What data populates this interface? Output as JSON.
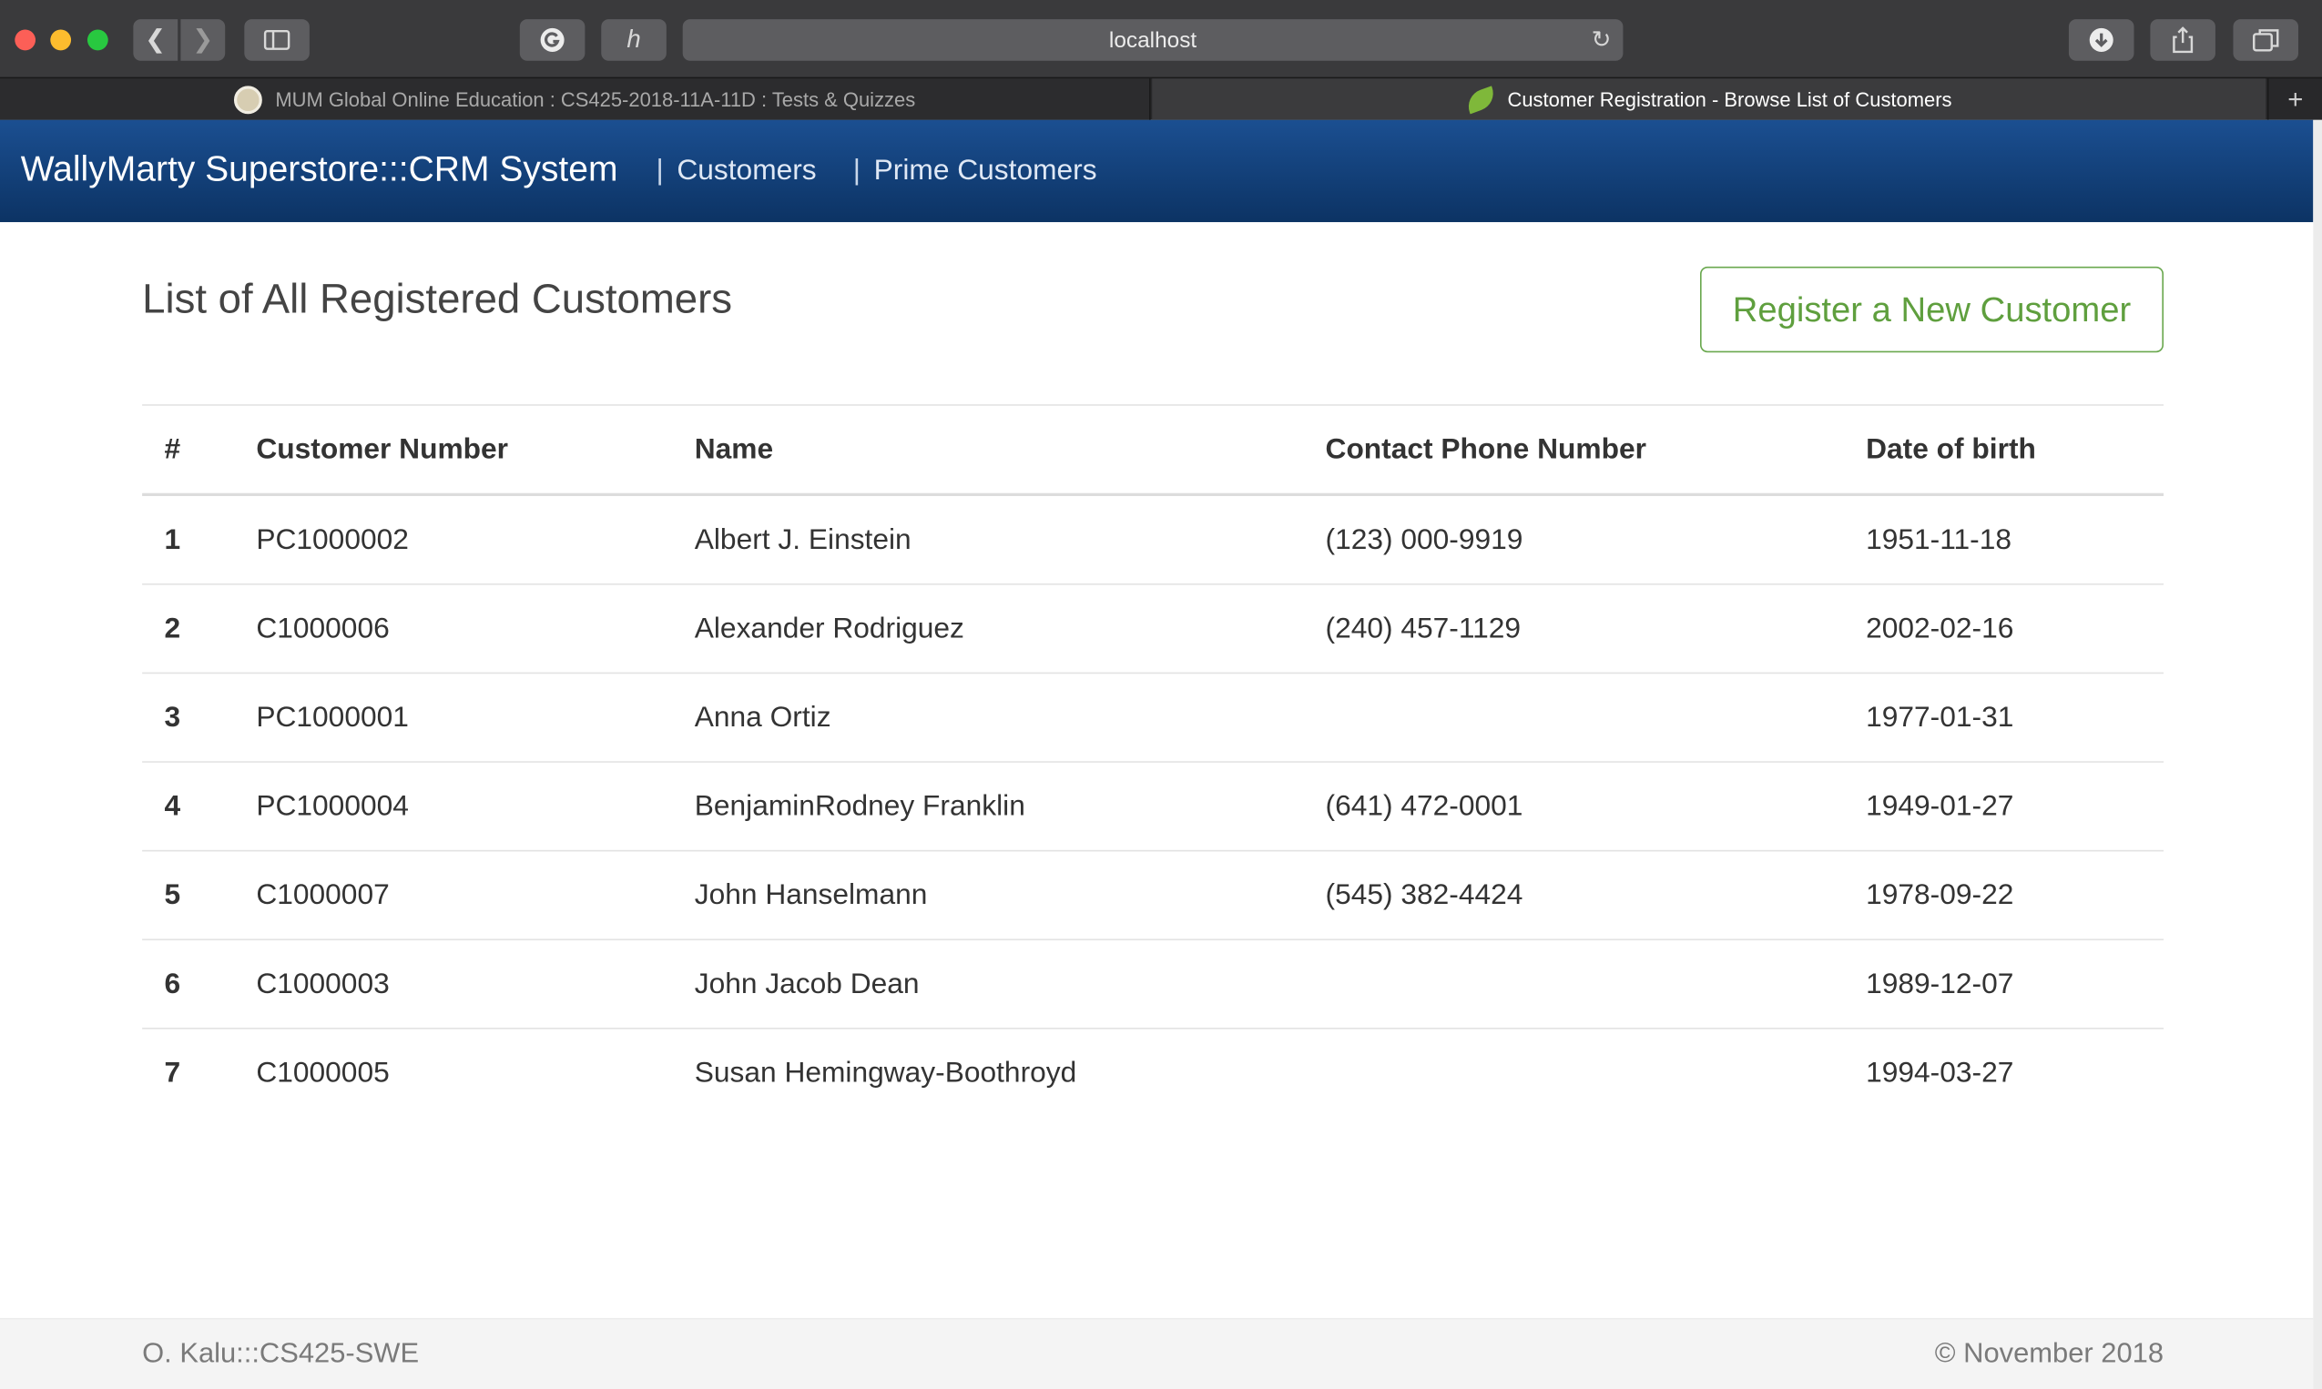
{
  "browser": {
    "url": "localhost",
    "tabs": [
      {
        "label": "MUM Global Online Education : CS425-2018-11A-11D : Tests & Quizzes",
        "active": false
      },
      {
        "label": "Customer Registration - Browse List of Customers",
        "active": true
      }
    ],
    "new_tab": "+"
  },
  "app": {
    "brand": "WallyMarty Superstore:::CRM System",
    "nav": [
      {
        "sep": "|",
        "label": "Customers"
      },
      {
        "sep": "|",
        "label": "Prime Customers"
      }
    ]
  },
  "main": {
    "title": "List of All Registered Customers",
    "register_button": "Register a New Customer",
    "table": {
      "headers": [
        "#",
        "Customer Number",
        "Name",
        "Contact Phone Number",
        "Date of birth"
      ],
      "rows": [
        [
          "1",
          "PC1000002",
          "Albert J. Einstein",
          "(123) 000-9919",
          "1951-11-18"
        ],
        [
          "2",
          "C1000006",
          "Alexander Rodriguez",
          "(240) 457-1129",
          "2002-02-16"
        ],
        [
          "3",
          "PC1000001",
          "Anna Ortiz",
          "",
          "1977-01-31"
        ],
        [
          "4",
          "PC1000004",
          "BenjaminRodney Franklin",
          "(641) 472-0001",
          "1949-01-27"
        ],
        [
          "5",
          "C1000007",
          "John Hanselmann",
          "(545) 382-4424",
          "1978-09-22"
        ],
        [
          "6",
          "C1000003",
          "John Jacob Dean",
          "",
          "1989-12-07"
        ],
        [
          "7",
          "C1000005",
          "Susan Hemingway-Boothroyd",
          "",
          "1994-03-27"
        ]
      ]
    }
  },
  "footer": {
    "left": "O. Kalu:::CS425-SWE",
    "right": "© November 2018"
  },
  "colors": {
    "navbar": "#154480",
    "accent_green": "#5f9f3e"
  }
}
